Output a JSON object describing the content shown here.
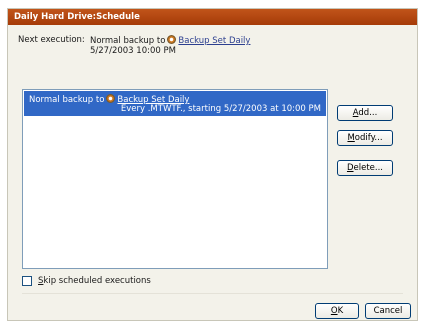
{
  "window": {
    "title": "Daily Hard Drive:Schedule"
  },
  "next_execution": {
    "label": "Next execution:",
    "prefix": "Normal backup to",
    "link": "Backup Set Daily",
    "datetime": "5/27/2003 10:00 PM",
    "icon": "backup-set-icon"
  },
  "schedules": [
    {
      "prefix": "Normal backup to",
      "link": "Backup Set Daily",
      "detail": "Every .MTWTF., starting 5/27/2003 at 10:00 PM",
      "selected": true,
      "icon": "backup-set-icon"
    }
  ],
  "buttons": {
    "add": {
      "first": "A",
      "rest": "dd..."
    },
    "modify": {
      "first": "M",
      "rest": "odify..."
    },
    "delete": {
      "first": "D",
      "rest": "elete..."
    },
    "ok": {
      "first": "O",
      "rest": "K"
    },
    "cancel": "Cancel"
  },
  "skip": {
    "first": "S",
    "rest": "kip scheduled executions",
    "checked": false
  },
  "colors": {
    "title_bar": "#b4470f",
    "selection": "#3168c6",
    "link": "#2c3f8f"
  }
}
